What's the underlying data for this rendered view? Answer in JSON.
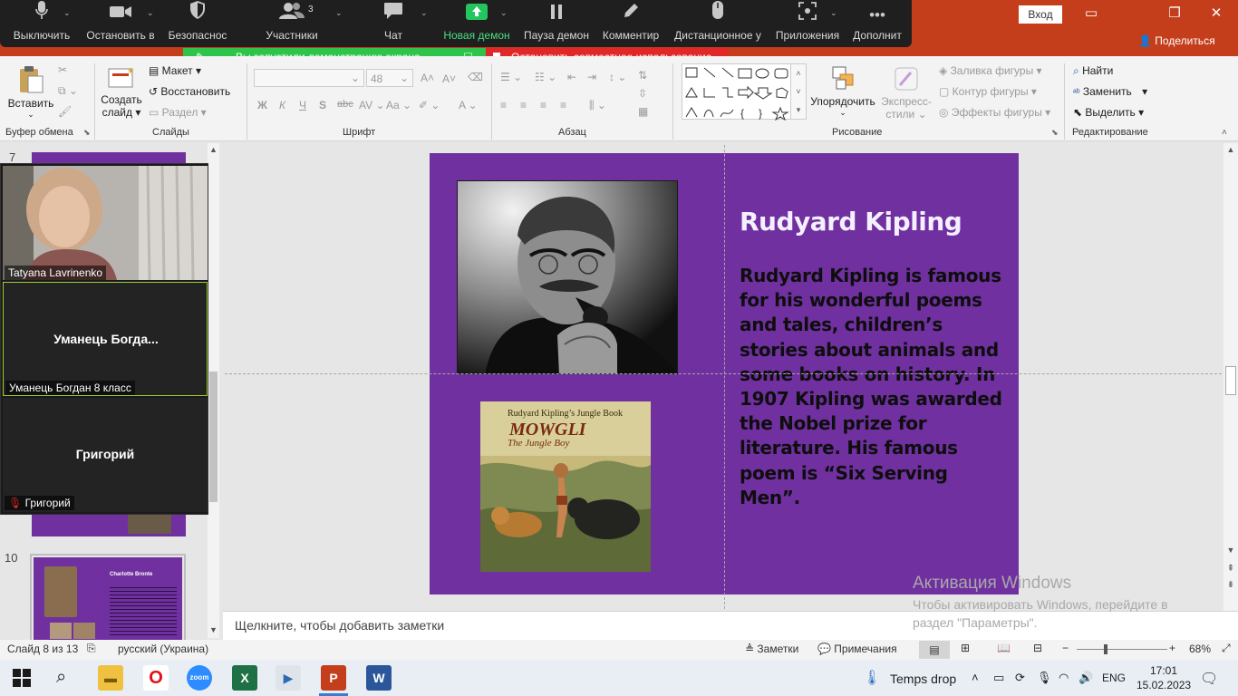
{
  "zoom_toolbar": {
    "items": [
      {
        "label": "Выключить",
        "icon": "microphone-icon"
      },
      {
        "label": "Остановить в",
        "icon": "video-camera-icon"
      },
      {
        "label": "Безопаснос",
        "icon": "shield-icon"
      },
      {
        "label": "Участники",
        "icon": "participants-icon"
      },
      {
        "label": "Чат",
        "icon": "chat-icon"
      },
      {
        "label": "Новая демон",
        "icon": "share-screen-icon"
      },
      {
        "label": "Пауза демон",
        "icon": "pause-icon"
      },
      {
        "label": "Комментир",
        "icon": "annotate-pencil-icon"
      },
      {
        "label": "Дистанционное у",
        "icon": "remote-control-mouse-icon"
      },
      {
        "label": "Приложения",
        "icon": "apps-icon"
      },
      {
        "label": "Дополнит",
        "icon": "more-icon"
      }
    ],
    "participants_count": "3"
  },
  "share_banner": {
    "status": "Вы запустили демонстрацию экрана",
    "stop": "Остановить совместное использование"
  },
  "titlebar": {
    "signin": "Вход",
    "share": "Поделиться"
  },
  "ribbon": {
    "clipboard": {
      "paste": "Вставить",
      "group": "Буфер обмена"
    },
    "slides": {
      "new_slide_line1": "Создать",
      "new_slide_line2": "слайд",
      "layout": "Макет",
      "reset": "Восстановить",
      "section": "Раздел",
      "group": "Слайды"
    },
    "font": {
      "size": "48",
      "group": "Шрифт"
    },
    "paragraph": {
      "group": "Абзац"
    },
    "drawing": {
      "arrange": "Упорядочить",
      "quick_styles_line1": "Экспресс-",
      "quick_styles_line2": "стили",
      "fill": "Заливка фигуры",
      "outline": "Контур фигуры",
      "effects": "Эффекты фигуры",
      "group": "Рисование"
    },
    "editing": {
      "find": "Найти",
      "replace": "Заменить",
      "select": "Выделить",
      "group": "Редактирование"
    }
  },
  "thumbnails": {
    "slide7_number": "7",
    "slide10_number": "10",
    "slide10_title": "Charlotte Bronte"
  },
  "video_panel": {
    "tile1_name": "Tatyana Lavrinenko",
    "tile2_center": "Уманець  Богда...",
    "tile2_name": "Уманець Богдан 8 класс",
    "tile3_center": "Григорий",
    "tile3_name": "Григорий"
  },
  "slide": {
    "title": "Rudyard Kipling",
    "body": " Rudyard Kipling is famous for his wonderful poems and tales, children’s stories about animals and some books on history. In 1907 Kipling was awarded the Nobel prize for literature. His famous poem is “Six Serving Men”.",
    "book_line1": "Rudyard Kipling’s Jungle Book",
    "book_title": "MOWGLI",
    "book_subtitle": "The Jungle Boy"
  },
  "notes_placeholder": "Щелкните, чтобы добавить заметки",
  "activation": {
    "title": "Активация Windows",
    "line1": "Чтобы активировать Windows, перейдите в",
    "line2": "раздел \"Параметры\"."
  },
  "statusbar": {
    "slide_info": "Слайд 8 из 13",
    "language": "русский (Украина)",
    "notes": "Заметки",
    "comments": "Примечания",
    "zoom": "68%"
  },
  "taskbar": {
    "weather": "Temps drop",
    "lang": "ENG",
    "time": "17:01",
    "date": "15.02.2023"
  },
  "colors": {
    "slide_bg": "#7030a0",
    "titlebar": "#c43e1c",
    "banner_green": "#2ec449",
    "banner_red": "#e02828"
  }
}
